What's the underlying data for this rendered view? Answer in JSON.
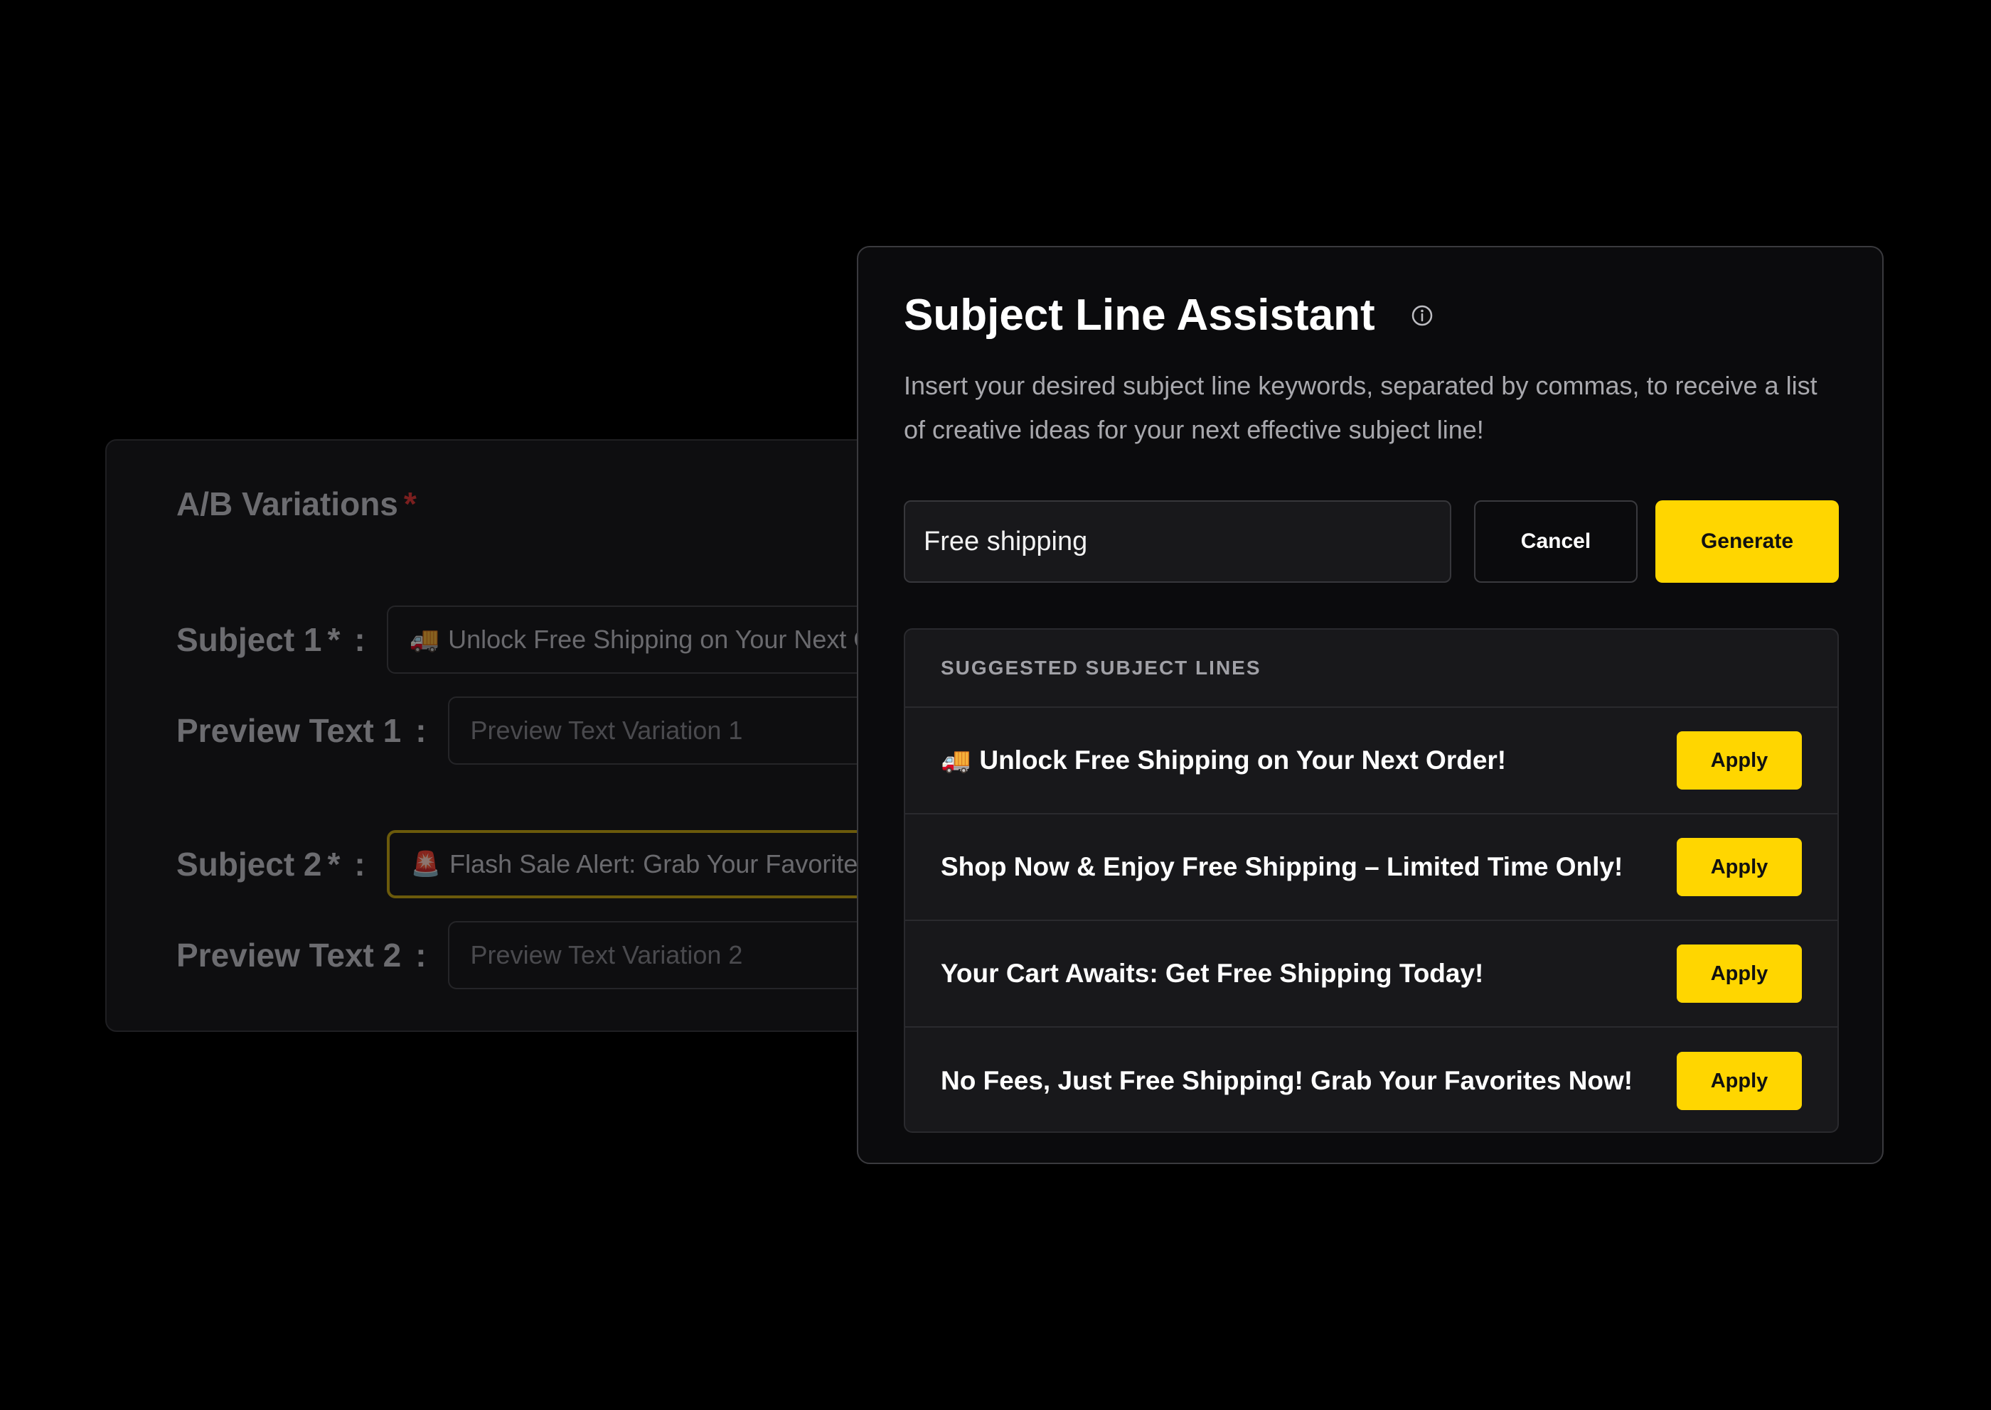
{
  "ab_variations": {
    "title": "A/B Variations",
    "required_mark": "*",
    "rows": [
      {
        "label": "Subject 1",
        "required": "*",
        "colon": ":",
        "emoji": "🚚",
        "value": "Unlock Free Shipping on Your Next Order!"
      },
      {
        "label": "Preview Text 1",
        "colon": ":",
        "placeholder": "Preview Text Variation 1"
      },
      {
        "label": "Subject 2",
        "required": "*",
        "colon": ":",
        "emoji": "🚨",
        "value": "Flash Sale Alert: Grab Your Favorites Now!"
      },
      {
        "label": "Preview Text 2",
        "colon": ":",
        "placeholder": "Preview Text Variation 2"
      }
    ]
  },
  "modal": {
    "title": "Subject Line Assistant",
    "info_icon": "info-circle-icon",
    "description": "Insert your desired subject line keywords, separated by commas, to receive a list of creative ideas for your next effective subject line!",
    "keyword_input_value": "Free shipping",
    "cancel_label": "Cancel",
    "generate_label": "Generate",
    "suggestions_header": "SUGGESTED SUBJECT LINES",
    "suggestions": [
      {
        "emoji": "🚚",
        "text": "Unlock Free Shipping on Your Next Order!",
        "apply_label": "Apply"
      },
      {
        "emoji": "",
        "text": "Shop Now & Enjoy Free Shipping – Limited Time Only!",
        "apply_label": "Apply"
      },
      {
        "emoji": "",
        "text": "Your Cart Awaits: Get Free Shipping Today!",
        "apply_label": "Apply"
      },
      {
        "emoji": "",
        "text": "No Fees, Just Free Shipping! Grab Your Favorites Now!",
        "apply_label": "Apply"
      }
    ]
  },
  "colors": {
    "accent": "#ffd600",
    "background": "#000000",
    "modal_bg": "#0b0b0d",
    "required_red": "#7a1f1f"
  }
}
